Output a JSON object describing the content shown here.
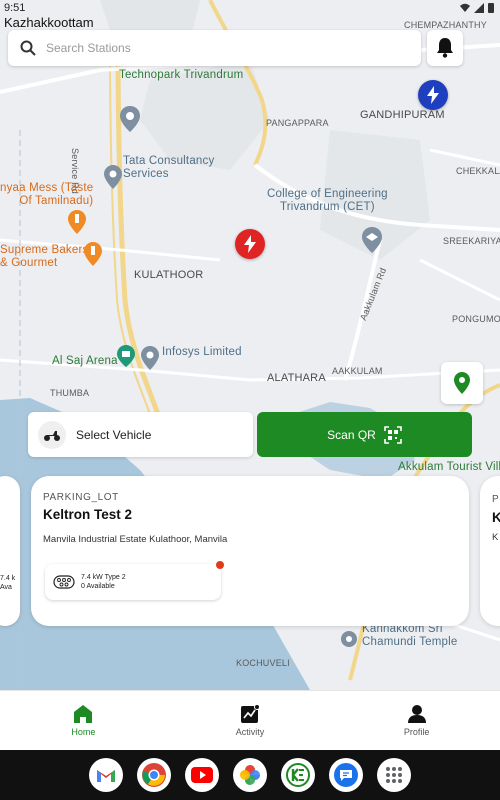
{
  "status_bar": {
    "time": "9:51",
    "location": "Kazhakkoottam"
  },
  "search": {
    "placeholder": "Search Stations"
  },
  "map": {
    "labels": {
      "chempazhanthy": "CHEMPAZHANTHY",
      "technopark": "Technopark Trivandrum",
      "pangappara": "PANGAPPARA",
      "gandhipuram": "GANDHIPURAM",
      "service_rd": "Service Rd",
      "tcs": "Tata Consultancy\nServices",
      "chekkala": "CHEKKALA",
      "mess": "nyaa Mess (Taste\nOf Tamilnadu)",
      "cet": "College of Engineering\nTrivandrum (CET)",
      "sreekariyam": "SREEKARIYAM",
      "bakers": "Supreme Bakers\n& Gourmet",
      "kulathoor": "KULATHOOR",
      "akkulam_rd": "Aakkulam Rd",
      "pongumood": "PONGUMOOD",
      "infosys": "Infosys Limited",
      "al_saj": "Al Saj Arena",
      "alathara": "ALATHARA",
      "aakkulam": "AAKKULAM",
      "thumba": "THUMBA",
      "tourist_village": "Akkulam Tourist Village",
      "kochuveli": "KOCHUVELI",
      "temple": "Kannakkom Sri\nChamundi Temple"
    }
  },
  "actions": {
    "select_vehicle": "Select Vehicle",
    "scan_qr": "Scan QR"
  },
  "station_card": {
    "type": "PARKING_LOT",
    "name": "Keltron Test 2",
    "address": "Manvila Industrial Estate Kulathoor, Manvila",
    "connector": {
      "spec": "7.4 kW Type 2",
      "availability": "0 Available"
    }
  },
  "partial_card_right": {
    "type": "P",
    "name": "K",
    "addr": "K"
  },
  "partial_card_left": {
    "line1": "7.4 k",
    "line2": "Ava"
  },
  "nav": {
    "items": [
      {
        "label": "Home",
        "icon": "home-icon"
      },
      {
        "label": "Activity",
        "icon": "activity-icon"
      },
      {
        "label": "Profile",
        "icon": "profile-icon"
      }
    ],
    "active": "Home"
  },
  "colors": {
    "brand_green": "#1e8a23",
    "alert_red": "#e23a15",
    "blue_marker": "#1f3fbf"
  },
  "dock": {
    "apps": [
      "gmail-icon",
      "chrome-icon",
      "youtube-icon",
      "photos-icon",
      "keltron-app-icon",
      "messages-icon",
      "app-drawer-icon"
    ]
  }
}
